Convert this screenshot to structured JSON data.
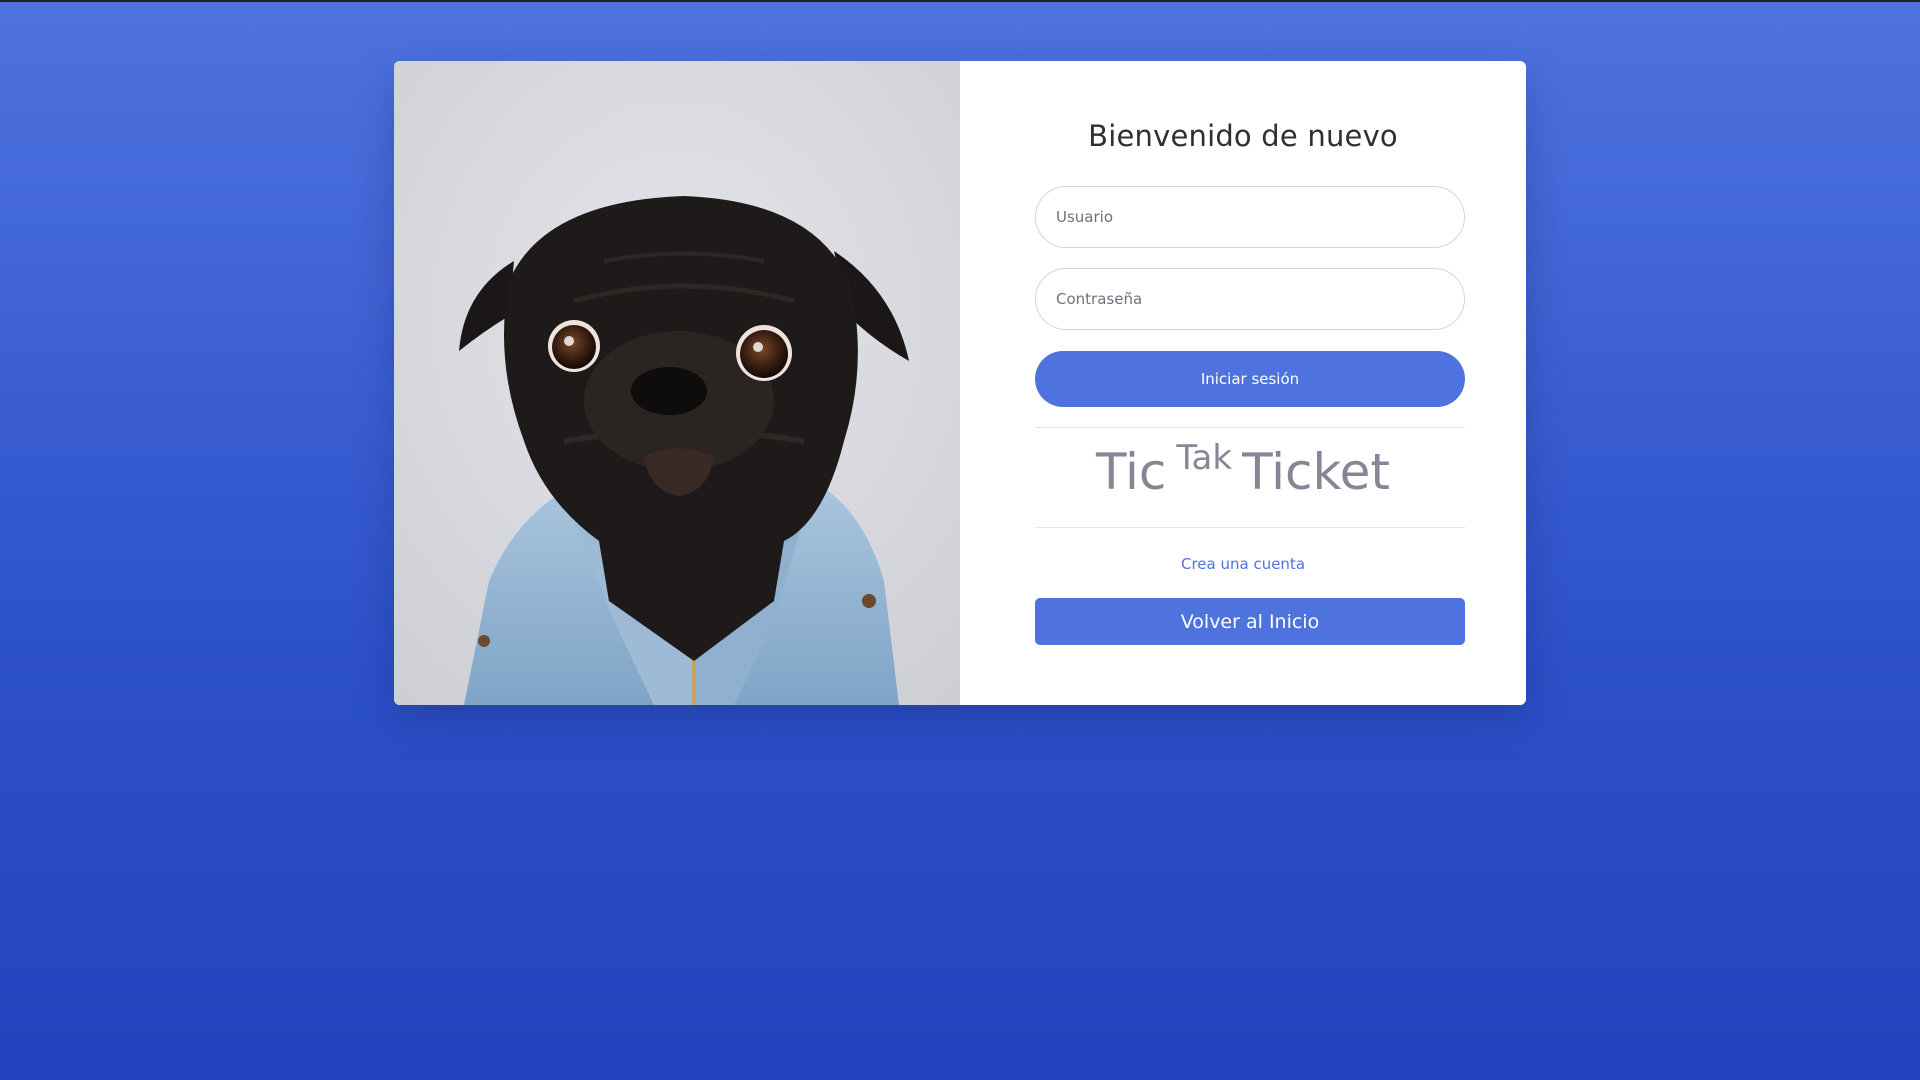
{
  "login": {
    "title": "Bienvenido de nuevo",
    "username_placeholder": "Usuario",
    "password_placeholder": "Contraseña",
    "submit_label": "Iniciar sesión",
    "brand": {
      "part1": "Tic",
      "part2": "Tak",
      "part3": "Ticket"
    },
    "create_account_label": "Crea una cuenta",
    "home_button_label": "Volver al Inicio"
  },
  "colors": {
    "primary": "#4e73df",
    "background_top": "#4e73df",
    "background_bottom": "#2243bd",
    "muted_text": "#858796"
  },
  "icons": {
    "hero_image": "pug-in-denim-jacket-photo"
  }
}
